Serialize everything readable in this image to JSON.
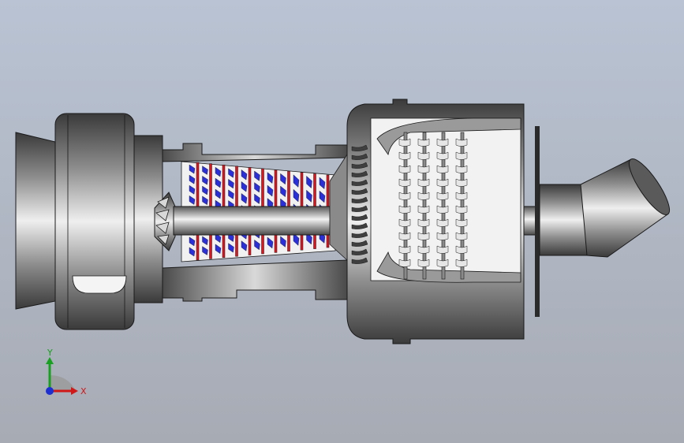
{
  "viewport": {
    "background_top": "#b9c3d3",
    "background_bottom": "#a7abb4"
  },
  "model": {
    "colors": {
      "metal_dark": "#3f3f3f",
      "metal_mid": "#8a8a8a",
      "metal_light": "#e6e6e6",
      "compressor_blue": "#2a2fd8",
      "compressor_red": "#e0141e",
      "outline": "#1a1a1a"
    }
  },
  "triad": {
    "x_label": "X",
    "y_label": "Y",
    "x_color": "#d01818",
    "y_color": "#18a020",
    "z_color": "#1d2fd0"
  }
}
